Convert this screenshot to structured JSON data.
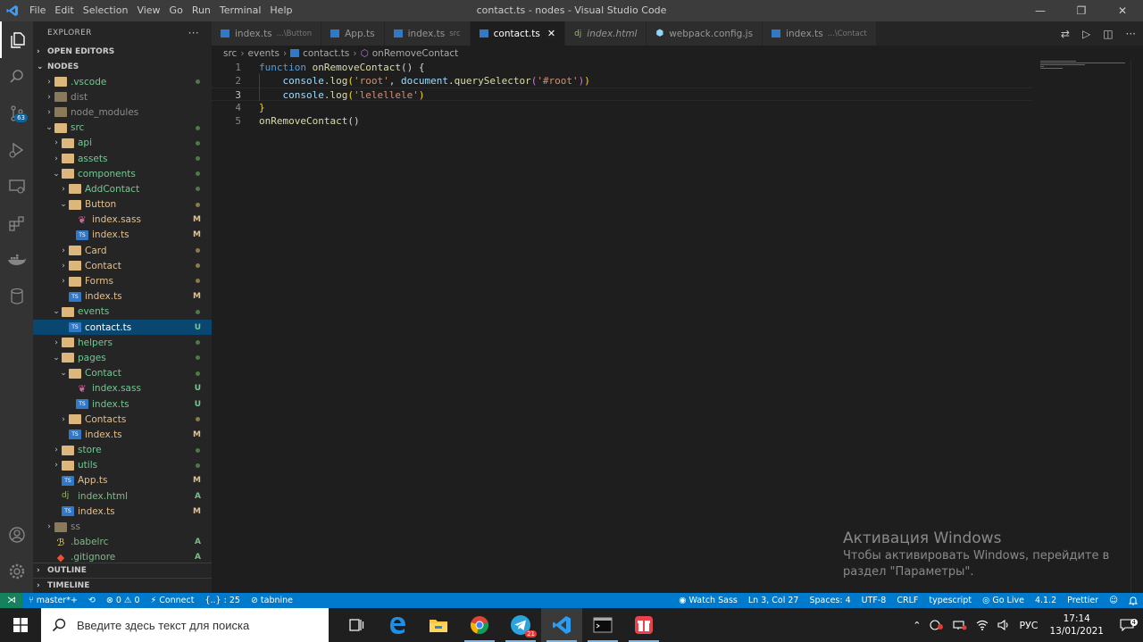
{
  "window": {
    "title": "contact.ts - nodes - Visual Studio Code",
    "menu": [
      "File",
      "Edit",
      "Selection",
      "View",
      "Go",
      "Run",
      "Terminal",
      "Help"
    ],
    "controls": {
      "minimize": "—",
      "maximize": "❐",
      "close": "✕"
    }
  },
  "activitybar": {
    "icons": [
      "explorer-icon",
      "search-icon",
      "source-control-icon",
      "run-debug-icon",
      "remote-explorer-icon",
      "extensions-icon",
      "docker-icon",
      "database-icon"
    ],
    "scm_badge": "63",
    "bottom_icons": [
      "account-icon",
      "settings-gear-icon"
    ]
  },
  "sidebar": {
    "header": "EXPLORER",
    "more": "···",
    "open_editors": "OPEN EDITORS",
    "root": "NODES",
    "tree": [
      {
        "name": ".vscode",
        "depth": 1,
        "type": "folder",
        "expanded": false,
        "status": "dot",
        "color": "#73c991"
      },
      {
        "name": "dist",
        "depth": 1,
        "type": "folder",
        "expanded": false,
        "status": "",
        "color": "#8c8c8c"
      },
      {
        "name": "node_modules",
        "depth": 1,
        "type": "folder",
        "expanded": false,
        "status": "",
        "color": "#8c8c8c"
      },
      {
        "name": "src",
        "depth": 1,
        "type": "folder",
        "expanded": true,
        "status": "dot",
        "color": "#73c991"
      },
      {
        "name": "api",
        "depth": 2,
        "type": "folder",
        "expanded": false,
        "status": "dot",
        "color": "#73c991"
      },
      {
        "name": "assets",
        "depth": 2,
        "type": "folder",
        "expanded": false,
        "status": "dot",
        "color": "#73c991"
      },
      {
        "name": "components",
        "depth": 2,
        "type": "folder",
        "expanded": true,
        "status": "dot",
        "color": "#73c991"
      },
      {
        "name": "AddContact",
        "depth": 3,
        "type": "folder",
        "expanded": false,
        "status": "dot",
        "color": "#73c991"
      },
      {
        "name": "Button",
        "depth": 3,
        "type": "folder",
        "expanded": true,
        "status": "dot",
        "color": "#e2c08d"
      },
      {
        "name": "index.sass",
        "depth": 4,
        "type": "sass",
        "status": "M",
        "color": "#e2c08d"
      },
      {
        "name": "index.ts",
        "depth": 4,
        "type": "ts",
        "status": "M",
        "color": "#e2c08d"
      },
      {
        "name": "Card",
        "depth": 3,
        "type": "folder",
        "expanded": false,
        "status": "dot",
        "color": "#e2c08d"
      },
      {
        "name": "Contact",
        "depth": 3,
        "type": "folder",
        "expanded": false,
        "status": "dot",
        "color": "#e2c08d"
      },
      {
        "name": "Forms",
        "depth": 3,
        "type": "folder",
        "expanded": false,
        "status": "dot",
        "color": "#e2c08d"
      },
      {
        "name": "index.ts",
        "depth": 3,
        "type": "ts",
        "status": "M",
        "color": "#e2c08d"
      },
      {
        "name": "events",
        "depth": 2,
        "type": "folder",
        "expanded": true,
        "status": "dot",
        "color": "#73c991"
      },
      {
        "name": "contact.ts",
        "depth": 3,
        "type": "ts",
        "status": "U",
        "color": "#ffffff",
        "selected": true
      },
      {
        "name": "helpers",
        "depth": 2,
        "type": "folder",
        "expanded": false,
        "status": "dot",
        "color": "#73c991"
      },
      {
        "name": "pages",
        "depth": 2,
        "type": "folder",
        "expanded": true,
        "status": "dot",
        "color": "#73c991"
      },
      {
        "name": "Contact",
        "depth": 3,
        "type": "folder",
        "expanded": true,
        "status": "dot",
        "color": "#73c991"
      },
      {
        "name": "index.sass",
        "depth": 4,
        "type": "sass",
        "status": "U",
        "color": "#73c991"
      },
      {
        "name": "index.ts",
        "depth": 4,
        "type": "ts",
        "status": "U",
        "color": "#73c991"
      },
      {
        "name": "Contacts",
        "depth": 3,
        "type": "folder",
        "expanded": false,
        "status": "dot",
        "color": "#e2c08d"
      },
      {
        "name": "index.ts",
        "depth": 3,
        "type": "ts",
        "status": "M",
        "color": "#e2c08d"
      },
      {
        "name": "store",
        "depth": 2,
        "type": "folder",
        "expanded": false,
        "status": "dot",
        "color": "#73c991"
      },
      {
        "name": "utils",
        "depth": 2,
        "type": "folder",
        "expanded": false,
        "status": "dot",
        "color": "#73c991"
      },
      {
        "name": "App.ts",
        "depth": 2,
        "type": "ts",
        "status": "M",
        "color": "#e2c08d"
      },
      {
        "name": "index.html",
        "depth": 2,
        "type": "html",
        "status": "A",
        "color": "#81b88b"
      },
      {
        "name": "index.ts",
        "depth": 2,
        "type": "ts",
        "status": "M",
        "color": "#e2c08d"
      },
      {
        "name": "ss",
        "depth": 1,
        "type": "folder",
        "expanded": false,
        "status": "",
        "color": "#8c8c8c"
      },
      {
        "name": ".babelrc",
        "depth": 1,
        "type": "babel",
        "status": "A",
        "color": "#81b88b"
      },
      {
        "name": ".gitignore",
        "depth": 1,
        "type": "git",
        "status": "A",
        "color": "#81b88b"
      }
    ],
    "outline": "OUTLINE",
    "timeline": "TIMELINE"
  },
  "tabs": [
    {
      "label": "index.ts",
      "desc": "...\\Button",
      "icon": "ts",
      "active": false,
      "italic": false
    },
    {
      "label": "App.ts",
      "desc": "",
      "icon": "ts",
      "active": false,
      "italic": false
    },
    {
      "label": "index.ts",
      "desc": "src",
      "icon": "ts",
      "active": false,
      "italic": false
    },
    {
      "label": "contact.ts",
      "desc": "",
      "icon": "ts",
      "active": true,
      "italic": false
    },
    {
      "label": "index.html",
      "desc": "",
      "icon": "dj",
      "active": false,
      "italic": true
    },
    {
      "label": "webpack.config.js",
      "desc": "",
      "icon": "wp",
      "active": false,
      "italic": false
    },
    {
      "label": "index.ts",
      "desc": "...\\Contact",
      "icon": "ts",
      "active": false,
      "italic": false
    }
  ],
  "tab_close": "✕",
  "tab_actions": [
    "compare-icon",
    "run-icon",
    "split-editor-icon",
    "more-actions-icon"
  ],
  "breadcrumb": [
    "src",
    "events",
    "contact.ts",
    "onRemoveContact"
  ],
  "editor": {
    "current_line": 3,
    "lines": [
      {
        "n": "1",
        "tokens": [
          [
            "kw",
            "function "
          ],
          [
            "fn",
            "onRemoveContact"
          ],
          [
            "pn",
            "() {"
          ]
        ]
      },
      {
        "n": "2",
        "tokens": [
          [
            "pn",
            "    "
          ],
          [
            "var",
            "console"
          ],
          [
            "pn",
            "."
          ],
          [
            "fn",
            "log"
          ],
          [
            "br1",
            "("
          ],
          [
            "str",
            "'root'"
          ],
          [
            "pn",
            ", "
          ],
          [
            "var",
            "document"
          ],
          [
            "pn",
            "."
          ],
          [
            "fn",
            "querySelector"
          ],
          [
            "br2",
            "("
          ],
          [
            "str",
            "'#root'"
          ],
          [
            "br2",
            ")"
          ],
          [
            "br1",
            ")"
          ]
        ]
      },
      {
        "n": "3",
        "tokens": [
          [
            "pn",
            "    "
          ],
          [
            "var",
            "console"
          ],
          [
            "pn",
            "."
          ],
          [
            "fn",
            "log"
          ],
          [
            "br1",
            "("
          ],
          [
            "str",
            "'lelellele'"
          ],
          [
            "br1",
            ")"
          ]
        ]
      },
      {
        "n": "4",
        "tokens": [
          [
            "br1",
            "}"
          ]
        ]
      },
      {
        "n": "5",
        "tokens": [
          [
            "fn",
            "onRemoveContact"
          ],
          [
            "pn",
            "()"
          ]
        ]
      }
    ]
  },
  "activation": {
    "title": "Активация Windows",
    "line1": "Чтобы активировать Windows, перейдите в",
    "line2": "раздел \"Параметры\"."
  },
  "statusbar": {
    "remote": "⋊",
    "branch": "master*+",
    "sync": "⟲",
    "problems": "⊗ 0 ⚠ 0",
    "connect": "Connect",
    "selection": "{..} : 25",
    "tabnine": "tabnine",
    "watch_sass": "Watch Sass",
    "position": "Ln 3, Col 27",
    "spaces": "Spaces: 4",
    "encoding": "UTF-8",
    "eol": "CRLF",
    "language": "typescript",
    "golive": "Go Live",
    "ts_version": "4.1.2",
    "prettier": "Prettier",
    "feedback": "☺",
    "bell": "🔔"
  },
  "taskbar": {
    "search_placeholder": "Введите здесь текст для поиска",
    "telegram_badge": "21",
    "lang": "РУС",
    "time": "17:14",
    "date": "13/01/2021",
    "notification_badge": "4"
  },
  "colors": {
    "accent": "#007acc",
    "selected": "#094771",
    "modified": "#e2c08d",
    "untracked": "#73c991",
    "added": "#81b88b"
  }
}
